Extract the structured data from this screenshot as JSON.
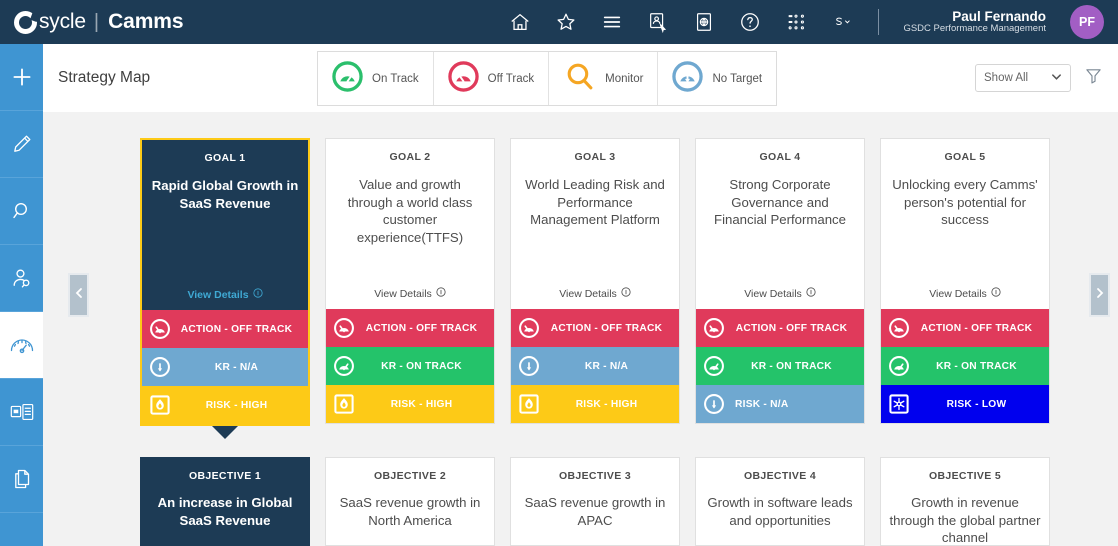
{
  "header": {
    "brand": "sycle",
    "brand_separator": "|",
    "brand_sub": "Camms",
    "icons": [
      "home-icon",
      "star-icon",
      "hamburger-menu-icon",
      "user-select-icon",
      "globe-box-icon",
      "help-icon",
      "apps-grid-icon",
      "s-dropdown-icon"
    ],
    "user": {
      "name": "Paul Fernando",
      "org": "GSDC Performance Management",
      "initials": "PF"
    }
  },
  "sidebar": {
    "items": [
      {
        "name": "add",
        "icon": "plus-icon",
        "active": false
      },
      {
        "name": "edit",
        "icon": "pencil-icon",
        "active": false
      },
      {
        "name": "search",
        "icon": "search-icon",
        "active": false
      },
      {
        "name": "people-search",
        "icon": "person-search-icon",
        "active": false
      },
      {
        "name": "performance",
        "icon": "gauge-icon",
        "active": true
      },
      {
        "name": "layout",
        "icon": "layout-icon",
        "active": false
      },
      {
        "name": "documents",
        "icon": "documents-icon",
        "active": false
      }
    ]
  },
  "page": {
    "title": "Strategy Map",
    "legend": [
      {
        "label": "On Track",
        "icon": "gauge-on-track-icon",
        "color": "#2bbf6c"
      },
      {
        "label": "Off Track",
        "icon": "gauge-off-track-icon",
        "color": "#e03a5b"
      },
      {
        "label": "Monitor",
        "icon": "magnifier-icon",
        "color": "#f5a623"
      },
      {
        "label": "No Target",
        "icon": "gauge-no-target-icon",
        "color": "#6fa8d0"
      }
    ],
    "show_all": {
      "label": "Show All",
      "caret": "chevron-down-icon"
    },
    "filter_icon": "filter-icon",
    "nav_prev": "chevron-left-icon",
    "nav_next": "chevron-right-icon"
  },
  "colors": {
    "navy": "#1d3b55",
    "sidebar_blue": "#3f95d2",
    "selected_border": "#fdca17",
    "off_track_red": "#e03a5b",
    "on_track_green": "#24c36a",
    "no_target_blue": "#6fa8d0",
    "risk_high_yellow": "#fdca17",
    "risk_low_blue": "#0000ee",
    "page_bg": "#f2f2f2"
  },
  "goals": [
    {
      "kicker": "GOAL 1",
      "title": "Rapid Global Growth in SaaS Revenue",
      "view_details": "View Details",
      "selected": true,
      "statuses": [
        {
          "label": "ACTION - OFF TRACK",
          "bg": "#e03a5b",
          "icon": "gauge-off-track-icon",
          "align": "center"
        },
        {
          "label": "KR - N/A",
          "bg": "#6fa8d0",
          "icon": "gauge-no-target-icon",
          "align": "center"
        },
        {
          "label": "RISK - HIGH",
          "bg": "#fdca17",
          "icon": "flame-icon",
          "align": "center"
        }
      ]
    },
    {
      "kicker": "GOAL 2",
      "title": "Value and growth through a world class customer experience(TTFS)",
      "view_details": "View Details",
      "selected": false,
      "statuses": [
        {
          "label": "ACTION - OFF TRACK",
          "bg": "#e03a5b",
          "icon": "gauge-off-track-icon",
          "align": "center"
        },
        {
          "label": "KR - ON TRACK",
          "bg": "#24c36a",
          "icon": "gauge-on-track-icon",
          "align": "center"
        },
        {
          "label": "RISK - HIGH",
          "bg": "#fdca17",
          "icon": "flame-icon",
          "align": "center"
        }
      ]
    },
    {
      "kicker": "GOAL 3",
      "title": "World Leading Risk and Performance Management Platform",
      "view_details": "View Details",
      "selected": false,
      "statuses": [
        {
          "label": "ACTION - OFF TRACK",
          "bg": "#e03a5b",
          "icon": "gauge-off-track-icon",
          "align": "center"
        },
        {
          "label": "KR - N/A",
          "bg": "#6fa8d0",
          "icon": "gauge-no-target-icon",
          "align": "center"
        },
        {
          "label": "RISK - HIGH",
          "bg": "#fdca17",
          "icon": "flame-icon",
          "align": "center"
        }
      ]
    },
    {
      "kicker": "GOAL 4",
      "title": "Strong Corporate Governance and Financial Performance",
      "view_details": "View Details",
      "selected": false,
      "statuses": [
        {
          "label": "ACTION - OFF TRACK",
          "bg": "#e03a5b",
          "icon": "gauge-off-track-icon",
          "align": "center"
        },
        {
          "label": "KR - ON TRACK",
          "bg": "#24c36a",
          "icon": "gauge-on-track-icon",
          "align": "center"
        },
        {
          "label": "RISK - N/A",
          "bg": "#6fa8d0",
          "icon": "gauge-no-target-icon",
          "align": "left"
        }
      ]
    },
    {
      "kicker": "GOAL 5",
      "title": "Unlocking every Camms' person's potential for success",
      "view_details": "View Details",
      "selected": false,
      "statuses": [
        {
          "label": "ACTION - OFF TRACK",
          "bg": "#e03a5b",
          "icon": "gauge-off-track-icon",
          "align": "center"
        },
        {
          "label": "KR - ON TRACK",
          "bg": "#24c36a",
          "icon": "gauge-on-track-icon",
          "align": "center"
        },
        {
          "label": "RISK - LOW",
          "bg": "#0000ee",
          "icon": "snowflake-icon",
          "align": "center"
        }
      ]
    }
  ],
  "objectives": [
    {
      "kicker": "OBJECTIVE 1",
      "title": "An increase in Global SaaS Revenue",
      "selected": true
    },
    {
      "kicker": "OBJECTIVE 2",
      "title": "SaaS revenue growth in North America",
      "selected": false
    },
    {
      "kicker": "OBJECTIVE 3",
      "title": "SaaS revenue growth in APAC",
      "selected": false
    },
    {
      "kicker": "OBJECTIVE 4",
      "title": "Growth in software leads and opportunities",
      "selected": false
    },
    {
      "kicker": "OBJECTIVE 5",
      "title": "Growth in revenue through the global partner channel",
      "selected": false
    }
  ]
}
